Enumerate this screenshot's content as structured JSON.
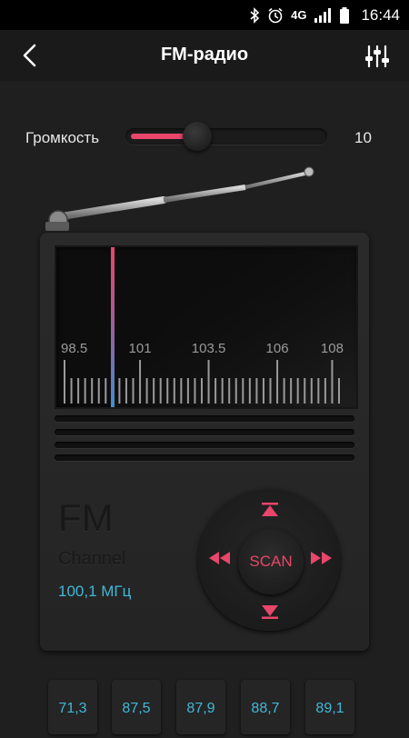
{
  "status_bar": {
    "icons": [
      "bluetooth-icon",
      "alarm-icon",
      "signal-icon",
      "battery-icon"
    ],
    "network": "4G",
    "time": "16:44"
  },
  "header": {
    "title": "FM-радио",
    "back_icon": "back-arrow-icon",
    "settings_icon": "equalizer-icon"
  },
  "volume": {
    "label": "Громкость",
    "value": "10",
    "level_fraction": 0.33
  },
  "dial": {
    "scale_labels": [
      "98.5",
      "101",
      "103.5",
      "106",
      "108"
    ],
    "needle_color": "#e8466a"
  },
  "display": {
    "band": "FM",
    "channel_label": "Channel",
    "frequency": "100,1 МГц"
  },
  "controls": {
    "scan_label": "SCAN",
    "up_icon": "seek-up-icon",
    "down_icon": "seek-down-icon",
    "prev_icon": "rewind-icon",
    "next_icon": "fast-forward-icon"
  },
  "presets": [
    "71,3",
    "87,5",
    "87,9",
    "88,7",
    "89,1"
  ],
  "colors": {
    "accent": "#e8466a",
    "frequency_text": "#41b8d8"
  }
}
